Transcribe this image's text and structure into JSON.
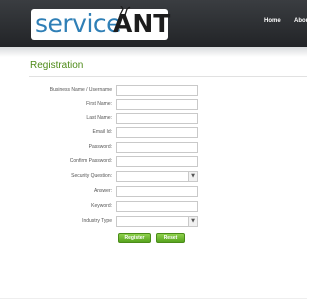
{
  "header": {
    "logo_service": "service",
    "logo_ant": "ANT",
    "nav": [
      "Home",
      "Abou"
    ]
  },
  "page": {
    "title": "Registration"
  },
  "form": {
    "fields": [
      {
        "label": "Business Name / Username",
        "type": "text",
        "value": ""
      },
      {
        "label": "First Name:",
        "type": "text",
        "value": ""
      },
      {
        "label": "Last Name:",
        "type": "text",
        "value": ""
      },
      {
        "label": "Email Id:",
        "type": "text",
        "value": ""
      },
      {
        "label": "Password:",
        "type": "password",
        "value": ""
      },
      {
        "label": "Confirm Password:",
        "type": "password",
        "value": ""
      },
      {
        "label": "Security Question:",
        "type": "select",
        "value": ""
      },
      {
        "label": "Answer:",
        "type": "text",
        "value": ""
      },
      {
        "label": "Keyword:",
        "type": "text",
        "value": ""
      },
      {
        "label": "Industry Type",
        "type": "select",
        "value": ""
      }
    ],
    "register_label": "Register",
    "reset_label": "Reset"
  },
  "colors": {
    "brand_blue": "#2f7fb6",
    "accent_green": "#4d8a17",
    "button_green": "#6ab92f",
    "topbar": "#2b2d30"
  }
}
